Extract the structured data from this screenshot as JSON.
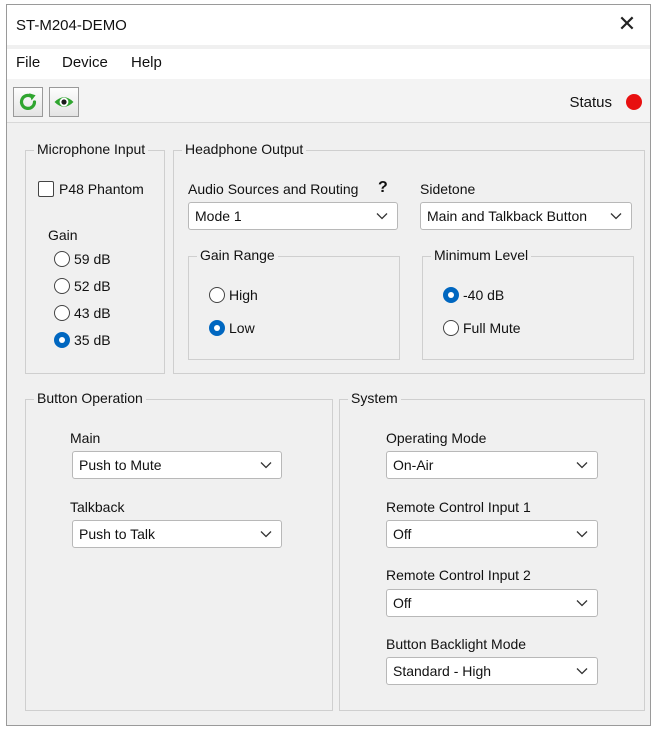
{
  "window": {
    "title": "ST-M204-DEMO"
  },
  "menu": {
    "file": "File",
    "device": "Device",
    "help": "Help"
  },
  "toolbar": {
    "refresh_icon": "refresh-icon",
    "view_icon": "eye-icon",
    "status_label": "Status",
    "status_color": "#e81010"
  },
  "microphone_input": {
    "title": "Microphone Input",
    "phantom_label": "P48 Phantom",
    "phantom_checked": false,
    "gain_label": "Gain",
    "gain_options": [
      "59 dB",
      "52 dB",
      "43 dB",
      "35 dB"
    ],
    "gain_selected": "35 dB"
  },
  "headphone_output": {
    "title": "Headphone Output",
    "routing_label": "Audio Sources and Routing",
    "routing_help": "?",
    "routing_value": "Mode 1",
    "sidetone_label": "Sidetone",
    "sidetone_value": "Main and Talkback Button",
    "gain_range": {
      "title": "Gain Range",
      "high": "High",
      "low": "Low",
      "selected": "Low"
    },
    "minimum_level": {
      "title": "Minimum Level",
      "db": "-40 dB",
      "mute": "Full Mute",
      "selected": "-40 dB"
    }
  },
  "button_operation": {
    "title": "Button Operation",
    "main_label": "Main",
    "main_value": "Push to Mute",
    "talkback_label": "Talkback",
    "talkback_value": "Push to Talk"
  },
  "system": {
    "title": "System",
    "operating_mode_label": "Operating Mode",
    "operating_mode_value": "On-Air",
    "remote1_label": "Remote Control Input 1",
    "remote1_value": "Off",
    "remote2_label": "Remote Control Input 2",
    "remote2_value": "Off",
    "backlight_label": "Button Backlight Mode",
    "backlight_value": "Standard - High"
  },
  "colors": {
    "accent": "#0067c0",
    "refresh": "#2fa52f",
    "window_bg": "#f0f0f0"
  }
}
